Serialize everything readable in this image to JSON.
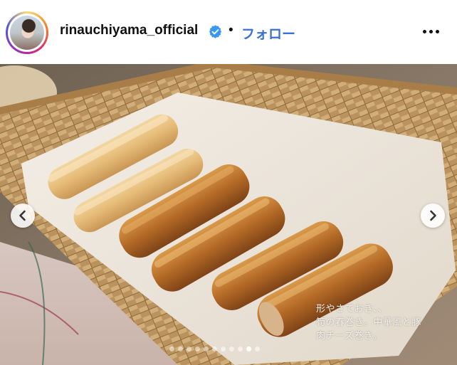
{
  "post": {
    "username": "rinauchiyama_official",
    "verified": true,
    "separator": "•",
    "follow_label": "フォロー",
    "more_icon": "more-horizontal-icon"
  },
  "media": {
    "caption_lines": [
      "形やさておき、、",
      "筍の春巻き。中華風と豚",
      "肉チーズ巻き。"
    ],
    "prev_icon": "chevron-left-icon",
    "next_icon": "chevron-right-icon",
    "carousel": {
      "total": 11,
      "active_index": 9
    }
  },
  "colors": {
    "follow": "#3b6fd1",
    "verified": "#3897f0",
    "basket": "#b98d58",
    "paper": "#efe9df",
    "spring_roll_light": "#e8c07c",
    "spring_roll_fried": "#b76f2a"
  }
}
